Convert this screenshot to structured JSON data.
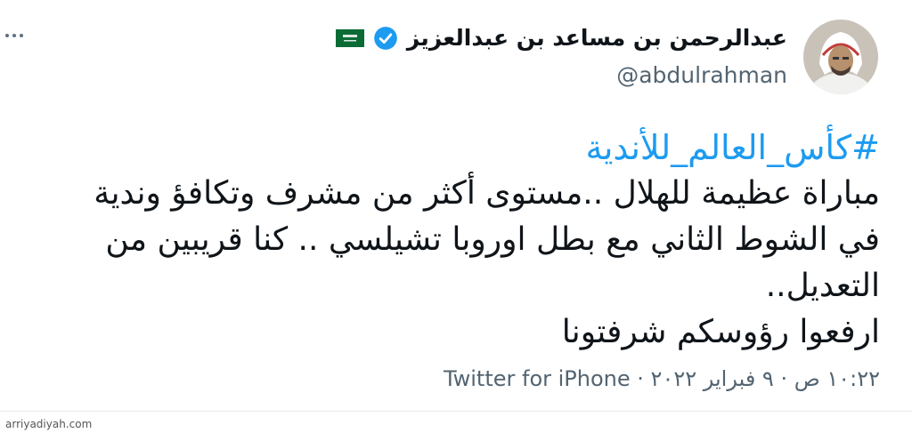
{
  "author": {
    "display_name": "عبدالرحمن بن مساعد بن عبدالعزيز",
    "handle": "@abdulrahman",
    "verified": true,
    "flag": "saudi-flag-icon"
  },
  "tweet": {
    "hashtag": "#كأس_العالم_للأندية",
    "lines": [
      "مباراة عظيمة للهلال ..مستوى أكثر من مشرف وتكافؤ وندية",
      "في الشوط الثاني مع بطل اوروبا تشيلسي .. كنا قريبين من",
      "التعديل..",
      "ارفعوا رؤوسكم شرفتونا"
    ],
    "meta": "١٠:٢٢ ص · ٩ فبراير ٢٠٢٢ · Twitter for iPhone"
  },
  "watermark": "arriyadiyah.com",
  "colors": {
    "link": "#1d9bf0",
    "text": "#0f1419",
    "muted": "#536471",
    "verified": "#1d9bf0"
  }
}
